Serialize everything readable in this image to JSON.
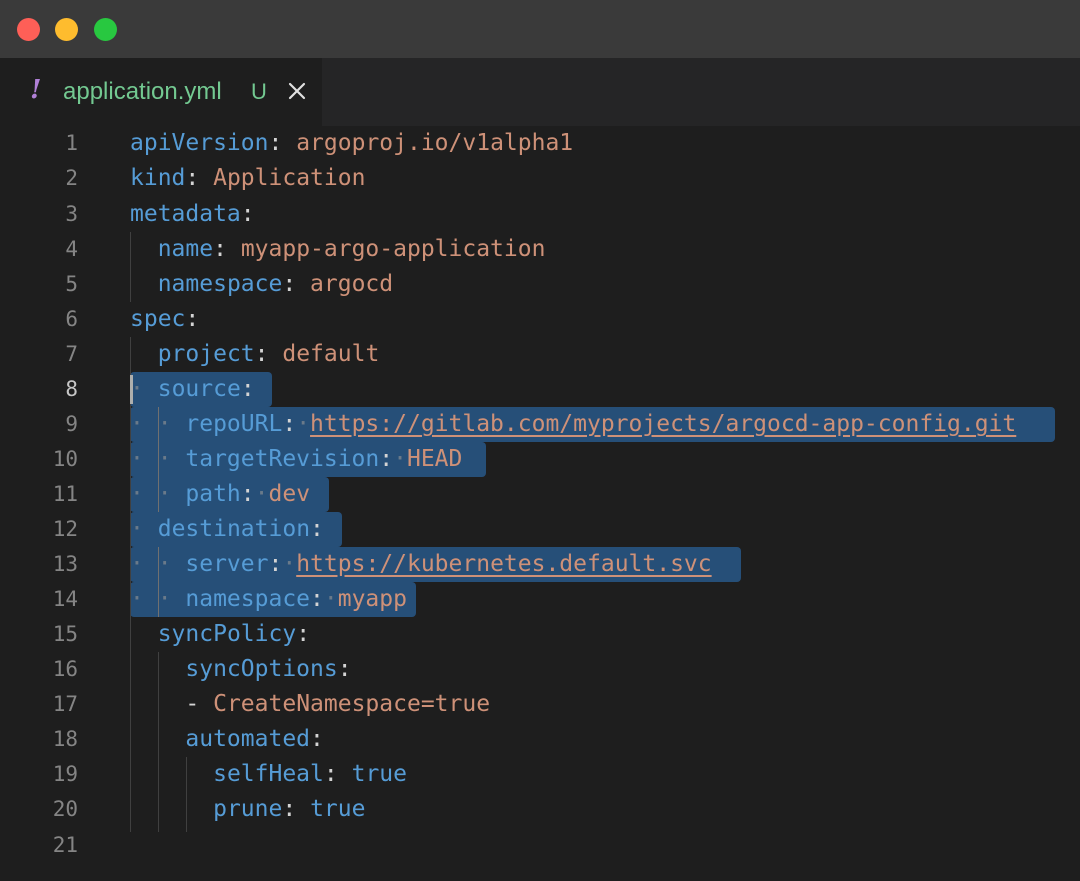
{
  "window": {
    "traffic_lights": [
      "close",
      "minimize",
      "zoom"
    ]
  },
  "tab": {
    "icon": "!",
    "filename": "application.yml",
    "status": "U",
    "close_icon": "close-icon"
  },
  "line_numbers": [
    "1",
    "2",
    "3",
    "4",
    "5",
    "6",
    "7",
    "8",
    "9",
    "10",
    "11",
    "12",
    "13",
    "14",
    "15",
    "16",
    "17",
    "18",
    "19",
    "20",
    "21"
  ],
  "active_line": "8",
  "code": {
    "l1": {
      "key": "apiVersion",
      "colon": ":",
      "value": "argoproj.io/v1alpha1"
    },
    "l2": {
      "key": "kind",
      "colon": ":",
      "value": "Application"
    },
    "l3": {
      "key": "metadata",
      "colon": ":"
    },
    "l4": {
      "key": "name",
      "colon": ":",
      "value": "myapp-argo-application"
    },
    "l5": {
      "key": "namespace",
      "colon": ":",
      "value": "argocd"
    },
    "l6": {
      "key": "spec",
      "colon": ":"
    },
    "l7": {
      "key": "project",
      "colon": ":",
      "value": "default"
    },
    "l8": {
      "key": "source",
      "colon": ":"
    },
    "l9": {
      "key": "repoURL",
      "colon": ":",
      "value": "https://gitlab.com/myprojects/argocd-app-config.git"
    },
    "l10": {
      "key": "targetRevision",
      "colon": ":",
      "value": "HEAD"
    },
    "l11": {
      "key": "path",
      "colon": ":",
      "value": "dev"
    },
    "l12": {
      "key": "destination",
      "colon": ":"
    },
    "l13": {
      "key": "server",
      "colon": ":",
      "value": "https://kubernetes.default.svc"
    },
    "l14": {
      "key": "namespace",
      "colon": ":",
      "value": "myapp"
    },
    "l15": {
      "key": "syncPolicy",
      "colon": ":"
    },
    "l16": {
      "key": "syncOptions",
      "colon": ":"
    },
    "l17": {
      "dash": "-",
      "value": "CreateNamespace=true"
    },
    "l18": {
      "key": "automated",
      "colon": ":"
    },
    "l19": {
      "key": "selfHeal",
      "colon": ":",
      "value": "true"
    },
    "l20": {
      "key": "prune",
      "colon": ":",
      "value": "true"
    },
    "l21": {}
  },
  "colors": {
    "key": "#569cd6",
    "string": "#ce9178",
    "selection": "#264f78",
    "tab_label": "#73c991",
    "tab_icon": "#b180d7"
  }
}
